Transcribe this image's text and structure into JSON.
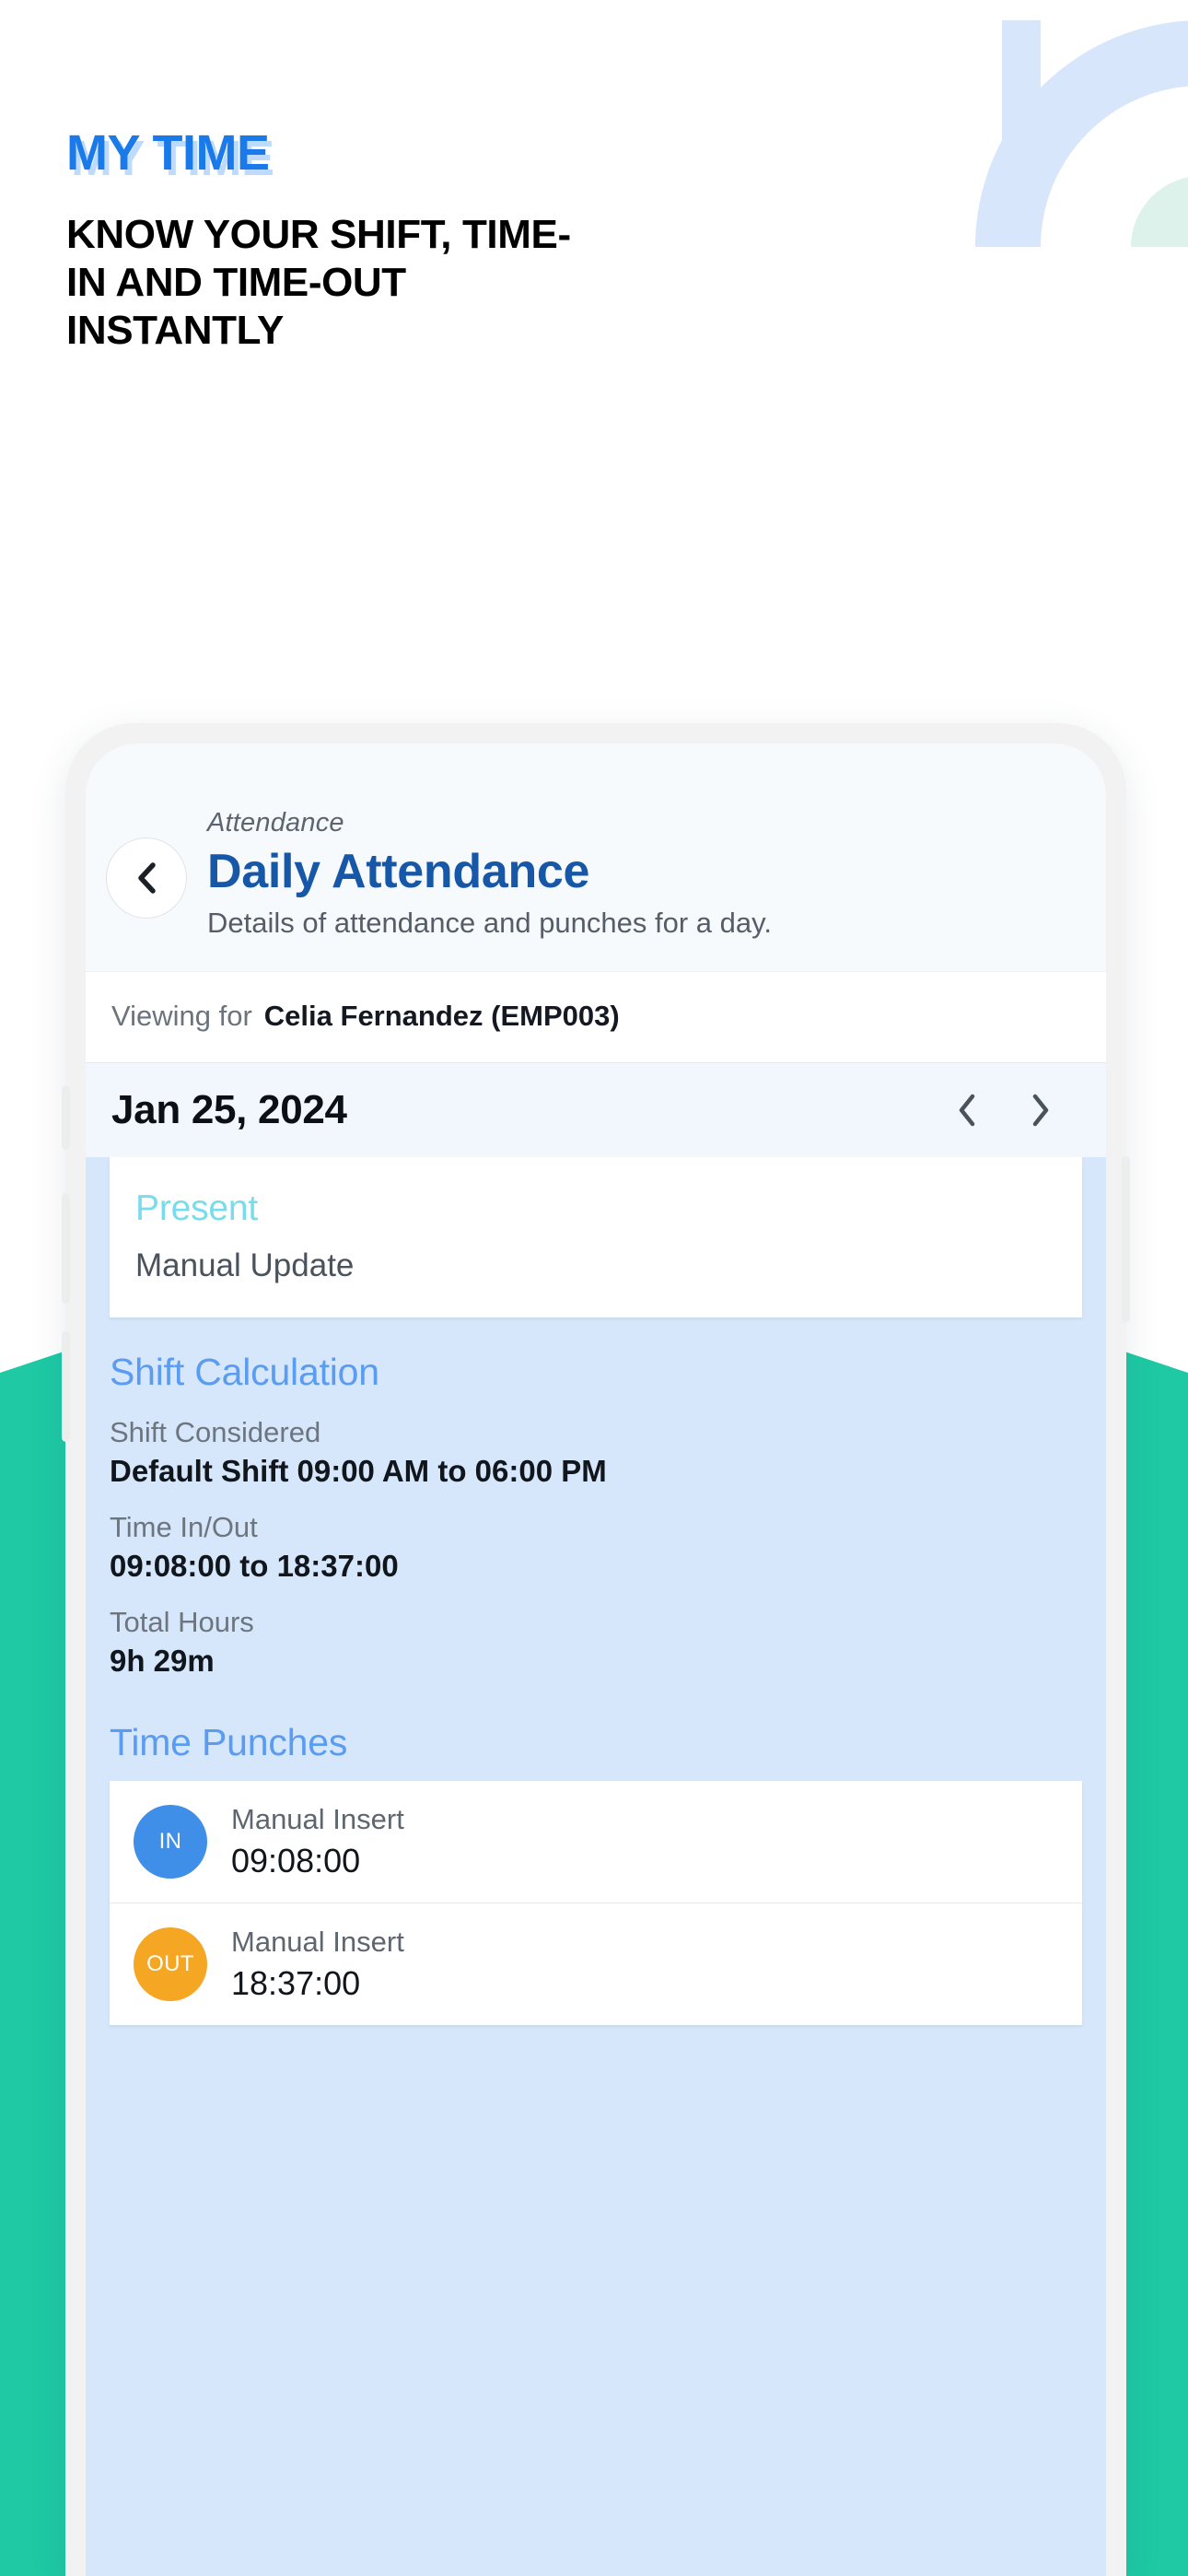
{
  "promo": {
    "title": "MY TIME",
    "subtitle": "KNOW YOUR SHIFT, TIME-IN AND TIME-OUT INSTANTLY",
    "title_color": "#1a7aea",
    "title_shadow_color": "#96c3fa"
  },
  "brand_mark": {
    "name": "r-logo-mark",
    "arc_color": "#d8e6fb",
    "accent_color": "#dcf2ea"
  },
  "theme": {
    "teal_band": "#1ec9a4",
    "phone_frame": "#f2f2f3",
    "screen_background": "#d6e6fb",
    "accent_blue": "#5a9cf1",
    "title_blue": "#1657a8",
    "present_cyan": "#79dced",
    "in_badge": "#3f8ee8",
    "out_badge": "#f5a623"
  },
  "app": {
    "header": {
      "breadcrumb": "Attendance",
      "title": "Daily Attendance",
      "description": "Details of attendance and punches for a day.",
      "back_icon": "chevron-left-icon"
    },
    "viewing": {
      "label": "Viewing for",
      "value": "Celia Fernandez (EMP003)"
    },
    "date_nav": {
      "date": "Jan 25, 2024",
      "prev_icon": "chevron-left-icon",
      "next_icon": "chevron-right-icon"
    },
    "status_card": {
      "status": "Present",
      "note": "Manual Update"
    },
    "shift_calculation": {
      "title": "Shift Calculation",
      "rows": [
        {
          "label": "Shift Considered",
          "value": "Default Shift 09:00 AM to 06:00 PM"
        },
        {
          "label": "Time In/Out",
          "value": "09:08:00 to 18:37:00"
        },
        {
          "label": "Total Hours",
          "value": "9h 29m"
        }
      ]
    },
    "time_punches": {
      "title": "Time Punches",
      "rows": [
        {
          "badge": "IN",
          "source": "Manual Insert",
          "time": "09:08:00"
        },
        {
          "badge": "OUT",
          "source": "Manual Insert",
          "time": "18:37:00"
        }
      ]
    }
  }
}
